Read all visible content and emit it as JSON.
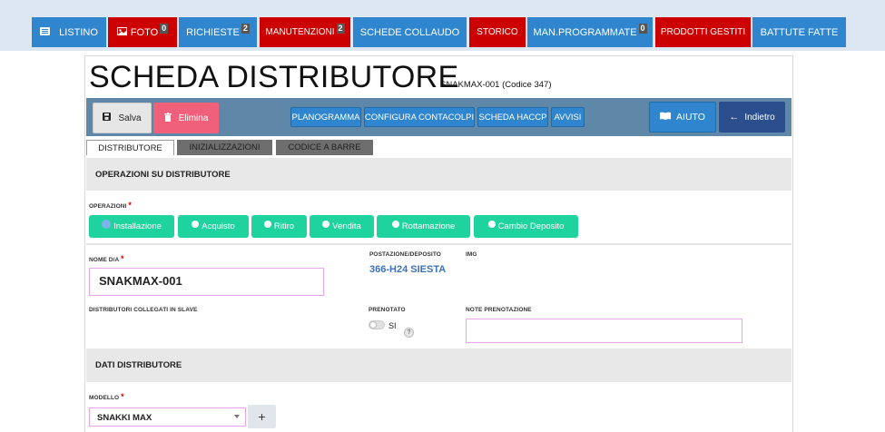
{
  "nav": {
    "listino": "LISTINO",
    "foto": "FOTO",
    "foto_badge": "0",
    "richieste": "RICHIESTE",
    "richieste_badge": "2",
    "manutenzioni": "MANUTENZIONI",
    "manutenzioni_badge": "2",
    "schede_collaudo": "SCHEDE COLLAUDO",
    "storico": "STORICO",
    "man_programmate": "MAN.PROGRAMMATE",
    "man_programmate_badge": "0",
    "prodotti_gestiti": "PRODOTTI GESTITI",
    "battute_fatte": "BATTUTE FATTE"
  },
  "page": {
    "title": "SCHEDA DISTRIBUTORE",
    "subtitle": "SNAKMAX-001 (Codice 347)"
  },
  "toolbar": {
    "salva": "Salva",
    "elimina": "Elimina",
    "planogramma": "PLANOGRAMMA",
    "configura_contacolpi": "CONFIGURA CONTACOLPI",
    "scheda_haccp": "SCHEDA HACCP",
    "avvisi": "AVVISI",
    "aiuto": "AIUTO",
    "indietro": "Indietro"
  },
  "tabs": [
    "DISTRIBUTORE",
    "INIZIALIZZAZIONI",
    "CODICE A BARRE"
  ],
  "section_operazioni": {
    "title": "OPERAZIONI SU DISTRIBUTORE",
    "label": "OPERAZIONI",
    "options": [
      "Installazione",
      "Acquisto",
      "Ritiro",
      "Vendita",
      "Rottamazione",
      "Cambio Deposito"
    ],
    "selected": "Installazione"
  },
  "fields": {
    "nome_label": "NOME D/A",
    "nome_value": "SNAKMAX-001",
    "postazione_label": "POSTAZIONE/DEPOSITO",
    "postazione_value": "366-H24 SIESTA",
    "img_label": "IMG",
    "collegati_label": "DISTRIBUTORI COLLEGATI IN SLAVE",
    "prenotato_label": "PRENOTATO",
    "prenotato_toggle_text": "SI",
    "help_icon": "?",
    "note_label": "NOTE PRENOTAZIONE",
    "note_value": ""
  },
  "section_dati": {
    "title": "DATI DISTRIBUTORE",
    "modello_label": "MODELLO",
    "modello_value": "SNAKKI MAX",
    "add_symbol": "+"
  },
  "required_mark": "*",
  "colors": {
    "nav_blue": "#2f86cf",
    "nav_red": "#cc0000",
    "op_green": "#1fd39e",
    "toolbar_bg": "#5f87a8",
    "delete_pink": "#f0607a",
    "back_navy": "#2b4f8c"
  },
  "icons": {
    "listino": "list-icon",
    "foto": "image-icon",
    "salva": "save-icon",
    "elimina": "trash-icon",
    "aiuto": "book-icon",
    "indietro": "arrow-left-icon"
  }
}
